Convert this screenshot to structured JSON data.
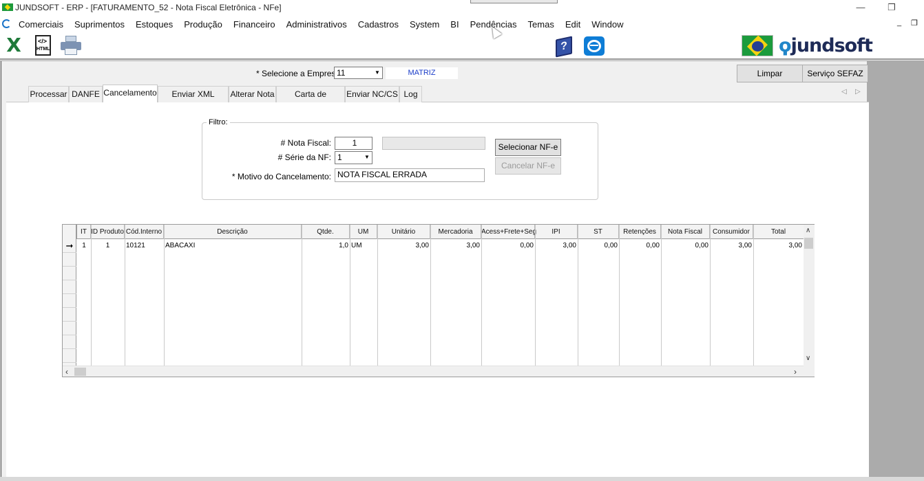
{
  "window": {
    "title": "JUNDSOFT - ERP - [FATURAMENTO_52 - Nota Fiscal Eletrônica - NFe]",
    "minimize": "—",
    "restore": "❐",
    "mdi_minimize": "_",
    "mdi_restore": "❐"
  },
  "menu": {
    "items": [
      "Comerciais",
      "Suprimentos",
      "Estoques",
      "Produção",
      "Financeiro",
      "Administrativos",
      "Cadastros",
      "System",
      "BI",
      "Pendências",
      "Temas",
      "Edit",
      "Window"
    ]
  },
  "toolbar": {
    "icons": [
      "excel-icon",
      "html-export-icon",
      "printer-icon",
      "help-book-icon",
      "teamviewer-icon",
      "brazil-flag-icon"
    ],
    "excel_glyph": "X",
    "html_label": "HTML",
    "help_glyph": "?",
    "brand": "jundsoft",
    "brand_mark": "ϙ",
    "colors": {
      "brand": "#1e2b57",
      "brand_accent": "#2186c9",
      "excel": "#1f7a3a"
    }
  },
  "header": {
    "empresa_label": "* Selecione a Empresa:",
    "empresa_value": "11",
    "empresa_name": "MATRIZ",
    "limpar_label": "Limpar",
    "sefaz_label": "Serviço SEFAZ"
  },
  "tabs": [
    {
      "label": "Processar"
    },
    {
      "label": "DANFE"
    },
    {
      "label": "Cancelamento"
    },
    {
      "label": "Enviar XML Cliente"
    },
    {
      "label": "Alterar Nota"
    },
    {
      "label": "Carta de Correção"
    },
    {
      "label": "Enviar NC/CS"
    },
    {
      "label": "Log"
    }
  ],
  "active_tab": "Cancelamento",
  "filter": {
    "title": "Filtro:",
    "nota_label": "# Nota Fiscal:",
    "nota_value": "1",
    "serie_label": "# Série da NF:",
    "serie_value": "1",
    "motivo_label": "* Motivo do Cancelamento:",
    "motivo_value": "NOTA FISCAL ERRADA",
    "select_button": "Selecionar NF-e",
    "cancel_button": "Cancelar NF-e"
  },
  "grid": {
    "columns": [
      "IT",
      "ID Produto",
      "Cód.Interno",
      "Descrição",
      "Qtde.",
      "UM",
      "Unitário",
      "Mercadoria",
      "Acess+Frete+Seg",
      "IPI",
      "ST",
      "Retenções",
      "Nota Fiscal",
      "Consumidor",
      "Total"
    ],
    "rows": [
      [
        "1",
        "1",
        "10121",
        "ABACAXI",
        "1,0",
        "UM",
        "3,00",
        "3,00",
        "0,00",
        "3,00",
        "0,00",
        "0,00",
        "0,00",
        "3,00",
        "3,00"
      ]
    ],
    "current_row_marker": "➞"
  }
}
